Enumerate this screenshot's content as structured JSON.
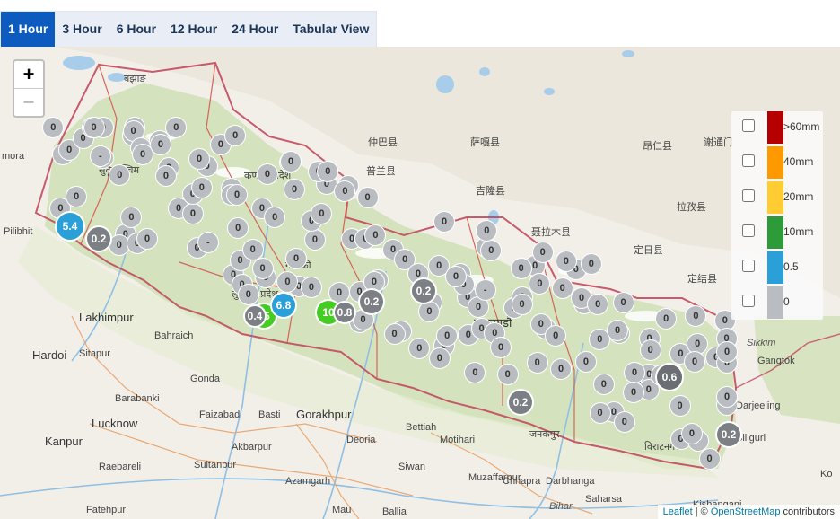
{
  "tabs": [
    {
      "label": "1 Hour",
      "active": true
    },
    {
      "label": "3 Hour",
      "active": false
    },
    {
      "label": "6 Hour",
      "active": false
    },
    {
      "label": "12 Hour",
      "active": false
    },
    {
      "label": "24 Hour",
      "active": false
    },
    {
      "label": "Tabular View",
      "active": false
    }
  ],
  "zoom": {
    "in_label": "+",
    "out_label": "−"
  },
  "legend": [
    {
      "label": ">60mm",
      "color": "#b50000"
    },
    {
      "label": "40mm",
      "color": "#ff9900"
    },
    {
      "label": "20mm",
      "color": "#ffcc33"
    },
    {
      "label": "10mm",
      "color": "#2e9b3b"
    },
    {
      "label": "0.5",
      "color": "#2a9fd8"
    },
    {
      "label": "0",
      "color": "#b9bcc0"
    }
  ],
  "place_labels": [
    {
      "text": "बझाङ",
      "cls": ""
    },
    {
      "text": "सुदूरपश्चिम",
      "cls": ""
    },
    {
      "text": "कर्णाली प्रदेश",
      "cls": ""
    },
    {
      "text": "लुम्बिनी प्रदेश",
      "cls": ""
    },
    {
      "text": "गण्डकी",
      "cls": ""
    },
    {
      "text": "काठमाडौं",
      "cls": "big"
    },
    {
      "text": "कोशी",
      "cls": ""
    },
    {
      "text": "विराटनगर",
      "cls": ""
    },
    {
      "text": "जनकपुर",
      "cls": ""
    },
    {
      "text": "Pilibhit",
      "cls": ""
    },
    {
      "text": "Lakhimpur",
      "cls": "big"
    },
    {
      "text": "Bahraich",
      "cls": ""
    },
    {
      "text": "Hardoi",
      "cls": "big"
    },
    {
      "text": "Sitapur",
      "cls": ""
    },
    {
      "text": "Gonda",
      "cls": ""
    },
    {
      "text": "Barabanki",
      "cls": ""
    },
    {
      "text": "Lucknow",
      "cls": "big"
    },
    {
      "text": "Kanpur",
      "cls": "big"
    },
    {
      "text": "Faizabad",
      "cls": ""
    },
    {
      "text": "Basti",
      "cls": ""
    },
    {
      "text": "Gorakhpur",
      "cls": "big"
    },
    {
      "text": "Akbarpur",
      "cls": ""
    },
    {
      "text": "Raebareli",
      "cls": ""
    },
    {
      "text": "Sultanpur",
      "cls": ""
    },
    {
      "text": "Azamgarh",
      "cls": ""
    },
    {
      "text": "Deoria",
      "cls": ""
    },
    {
      "text": "Bettiah",
      "cls": ""
    },
    {
      "text": "Motihari",
      "cls": ""
    },
    {
      "text": "Siwan",
      "cls": ""
    },
    {
      "text": "Muzaffarpur",
      "cls": ""
    },
    {
      "text": "Darbhanga",
      "cls": ""
    },
    {
      "text": "Chhapra",
      "cls": ""
    },
    {
      "text": "Saharsa",
      "cls": ""
    },
    {
      "text": "Bihar",
      "cls": "ital"
    },
    {
      "text": "Kishanganj",
      "cls": ""
    },
    {
      "text": "Gangtok",
      "cls": ""
    },
    {
      "text": "Darjeeling",
      "cls": ""
    },
    {
      "text": "Siliguri",
      "cls": ""
    },
    {
      "text": "Sikkim",
      "cls": "ital"
    },
    {
      "text": "Fatehpur",
      "cls": ""
    },
    {
      "text": "Mau",
      "cls": ""
    },
    {
      "text": "Ballia",
      "cls": ""
    },
    {
      "text": "仲巴县",
      "cls": ""
    },
    {
      "text": "萨嘎县",
      "cls": ""
    },
    {
      "text": "吉隆县",
      "cls": ""
    },
    {
      "text": "聂拉木县",
      "cls": ""
    },
    {
      "text": "定日县",
      "cls": ""
    },
    {
      "text": "拉孜县",
      "cls": ""
    },
    {
      "text": "昂仁县",
      "cls": ""
    },
    {
      "text": "谢通门",
      "cls": ""
    },
    {
      "text": "定结县",
      "cls": ""
    },
    {
      "text": "普兰县",
      "cls": ""
    },
    {
      "text": "mora",
      "cls": ""
    },
    {
      "text": "Ko",
      "cls": ""
    }
  ],
  "markers": [
    "0",
    "0",
    "0",
    "0",
    "0",
    "0",
    "0",
    "0",
    "0",
    "0",
    "0",
    "0",
    "-",
    "0",
    "0",
    "0",
    "0",
    "0",
    "0",
    "0",
    "0",
    "0",
    "0",
    "-",
    "0",
    "0",
    "0",
    "0",
    "0",
    "0",
    "0",
    "0",
    "0",
    "0",
    "0",
    "0",
    "-",
    "0",
    "0",
    "0",
    "0",
    "0",
    "0",
    "0",
    "0",
    "0",
    "0",
    "0",
    "0",
    "0",
    "0",
    "0",
    "0",
    "0",
    "0",
    "0",
    "0",
    "0",
    "0",
    "0",
    "0",
    "0",
    "0",
    "0",
    "0",
    "0",
    "0",
    "0",
    "0",
    "0",
    "0",
    "0",
    "0",
    "0",
    "0",
    "0",
    "0",
    "0",
    "0",
    "0",
    "0",
    "0",
    "0",
    "0",
    "0",
    "0",
    "0",
    "0",
    "0",
    "0",
    "0",
    "0",
    "0",
    "0",
    "0",
    "0",
    "0",
    "0",
    "0",
    "0",
    "0",
    "0",
    "0",
    "-",
    "0",
    "0",
    "0",
    "0",
    "0",
    "0",
    "0",
    "0",
    "0",
    "0",
    "0",
    "0",
    "0",
    "0",
    "0",
    "0",
    "0",
    "0",
    "0",
    "0",
    "0",
    "0",
    "0",
    "0",
    "0",
    "0",
    "0",
    "0",
    "0",
    "0",
    "0",
    "0",
    "0",
    "0",
    "0",
    "0",
    "0",
    "0",
    "0",
    "0",
    "0",
    "0",
    "0",
    "-",
    "0",
    "0",
    "0",
    "0",
    "0",
    "0",
    "0",
    "0",
    "0",
    "0",
    "0",
    "0"
  ],
  "featured_markers": [
    {
      "text": "5.4",
      "color": "#2a9fd8"
    },
    {
      "text": "0.2",
      "color": "#7c7f84"
    },
    {
      "text": "15",
      "color": "#44cc22"
    },
    {
      "text": "6.8",
      "color": "#2a9fd8"
    },
    {
      "text": "10",
      "color": "#44cc22"
    },
    {
      "text": "0.2",
      "color": "#7c7f84"
    },
    {
      "text": "0.2",
      "color": "#7c7f84"
    },
    {
      "text": "0.2",
      "color": "#7c7f84"
    },
    {
      "text": "0.6",
      "color": "#6b6e73"
    },
    {
      "text": "0.2",
      "color": "#7c7f84"
    },
    {
      "text": "0.8",
      "color": "#7c7f84"
    },
    {
      "text": "0.4",
      "color": "#7c7f84"
    }
  ],
  "attribution": {
    "leaflet": "Leaflet",
    "sep": " | © ",
    "osm": "OpenStreetMap",
    "rest": " contributors"
  }
}
